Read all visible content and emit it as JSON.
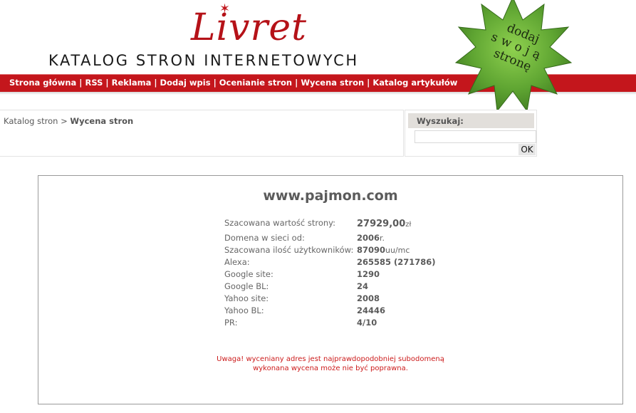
{
  "header": {
    "logo_text": "Livret",
    "tagline": "KATALOG STRON INTERNETOWYCH"
  },
  "nav": {
    "items": [
      {
        "label": "Strona główna"
      },
      {
        "label": "RSS"
      },
      {
        "label": "Reklama"
      },
      {
        "label": "Dodaj wpis"
      },
      {
        "label": "Ocenianie stron"
      },
      {
        "label": "Wycena stron"
      },
      {
        "label": "Katalog artykułów"
      }
    ],
    "separator": "|"
  },
  "promo": {
    "line1": "dodaj",
    "line2": "swoją",
    "line3": "stronę"
  },
  "breadcrumb": {
    "root": "Katalog stron",
    "separator": ">",
    "current": "Wycena stron"
  },
  "search": {
    "label": "Wyszukaj:",
    "value": "",
    "button": "OK"
  },
  "result": {
    "domain": "www.pajmon.com",
    "stats": [
      {
        "label": "Szacowana wartość strony:",
        "value": "27929,00",
        "unit": "zł"
      },
      {
        "label": "Domena w sieci od:",
        "value": "2006",
        "unit": "r."
      },
      {
        "label": "Szacowana ilość użytkowników:",
        "value": "87090",
        "unit": "uu/mc"
      },
      {
        "label": "Alexa:",
        "value": "265585 (271786)",
        "unit": ""
      },
      {
        "label": "Google site:",
        "value": "1290",
        "unit": ""
      },
      {
        "label": "Google BL:",
        "value": "24",
        "unit": ""
      },
      {
        "label": "Yahoo site:",
        "value": "2008",
        "unit": ""
      },
      {
        "label": "Yahoo BL:",
        "value": "24446",
        "unit": ""
      },
      {
        "label": "PR:",
        "value": "4/10",
        "unit": ""
      }
    ],
    "warning_line1": "Uwaga! wyceniany adres jest najprawdopodobniej subodomeną",
    "warning_line2": "wykonana wycena może nie być poprawna."
  },
  "colors": {
    "nav_bg": "#c4161c",
    "logo": "#b51218",
    "promo_star": "#5fa532",
    "warning": "#cc1b1b"
  }
}
